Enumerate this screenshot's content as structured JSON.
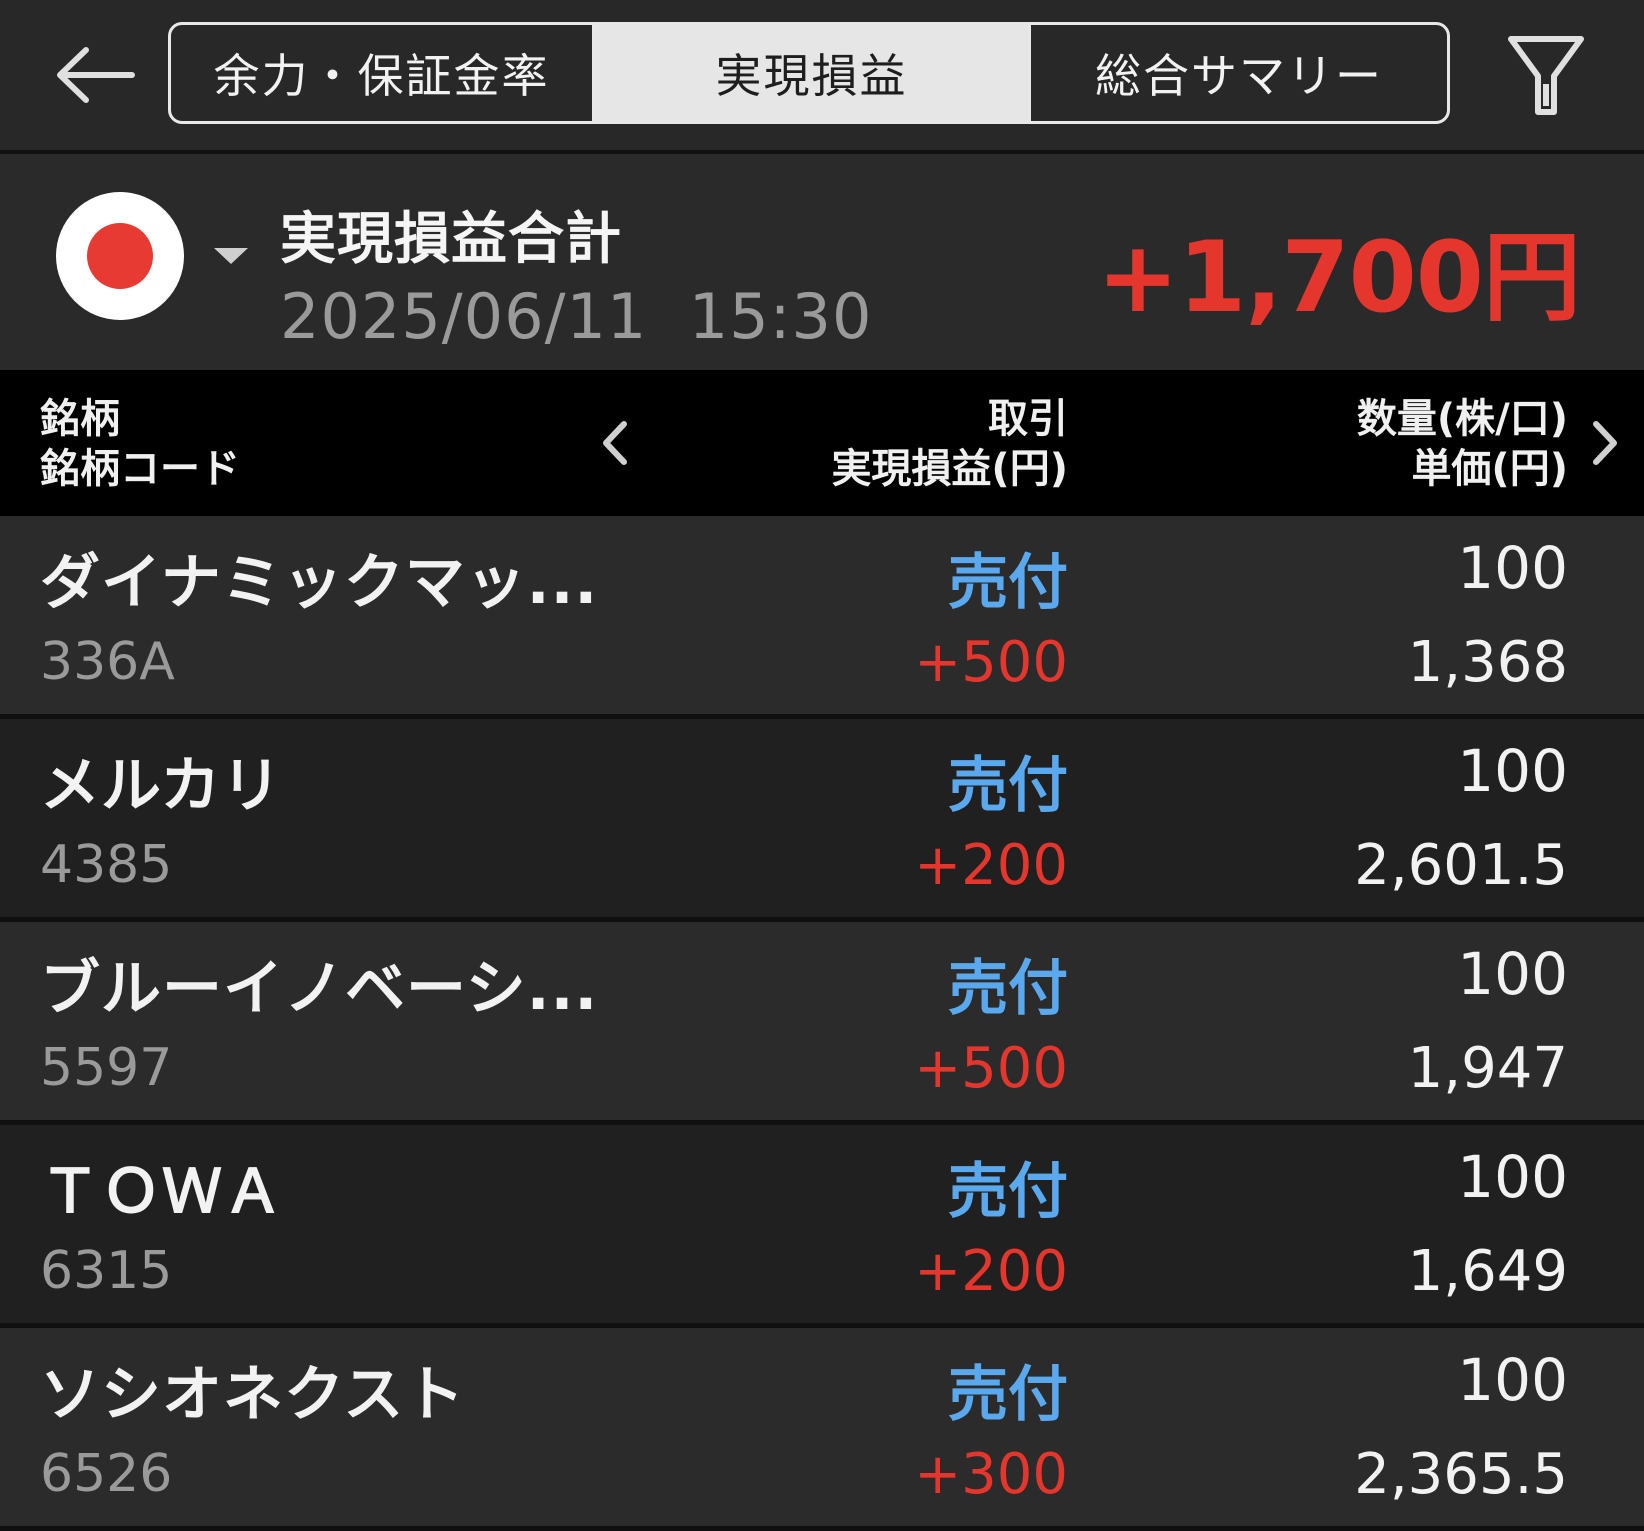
{
  "tabs": [
    {
      "label": "余力・保証金率",
      "active": false
    },
    {
      "label": "実現損益",
      "active": true
    },
    {
      "label": "総合サマリー",
      "active": false
    }
  ],
  "icons": {
    "back": "back-arrow-icon",
    "filter": "filter-icon",
    "flag": "japan-flag-icon",
    "caret": "caret-down-icon",
    "prev": "chevron-left-icon",
    "next": "chevron-right-icon"
  },
  "summary": {
    "title": "実現損益合計",
    "datetime": "2025/06/11  15:30",
    "total": "+1,700円"
  },
  "table": {
    "headers": {
      "col1_line1": "銘柄",
      "col1_line2": "銘柄コード",
      "col2_line1": "取引",
      "col2_line2": "実現損益(円)",
      "col3_line1": "数量(株/口)",
      "col3_line2": "単価(円)"
    },
    "rows": [
      {
        "name": "ダイナミックマッ...",
        "code": "336A",
        "trade": "売付",
        "pl": "+500",
        "qty": "100",
        "price": "1,368"
      },
      {
        "name": "メルカリ",
        "code": "4385",
        "trade": "売付",
        "pl": "+200",
        "qty": "100",
        "price": "2,601.5"
      },
      {
        "name": "ブルーイノベーシ...",
        "code": "5597",
        "trade": "売付",
        "pl": "+500",
        "qty": "100",
        "price": "1,947"
      },
      {
        "name": "ＴＯＷＡ",
        "code": "6315",
        "trade": "売付",
        "pl": "+200",
        "qty": "100",
        "price": "1,649"
      },
      {
        "name": "ソシオネクスト",
        "code": "6526",
        "trade": "売付",
        "pl": "+300",
        "qty": "100",
        "price": "2,365.5"
      }
    ]
  },
  "colors": {
    "positive": "#e5362d",
    "sell": "#5aa9ee",
    "background": "#262626"
  }
}
